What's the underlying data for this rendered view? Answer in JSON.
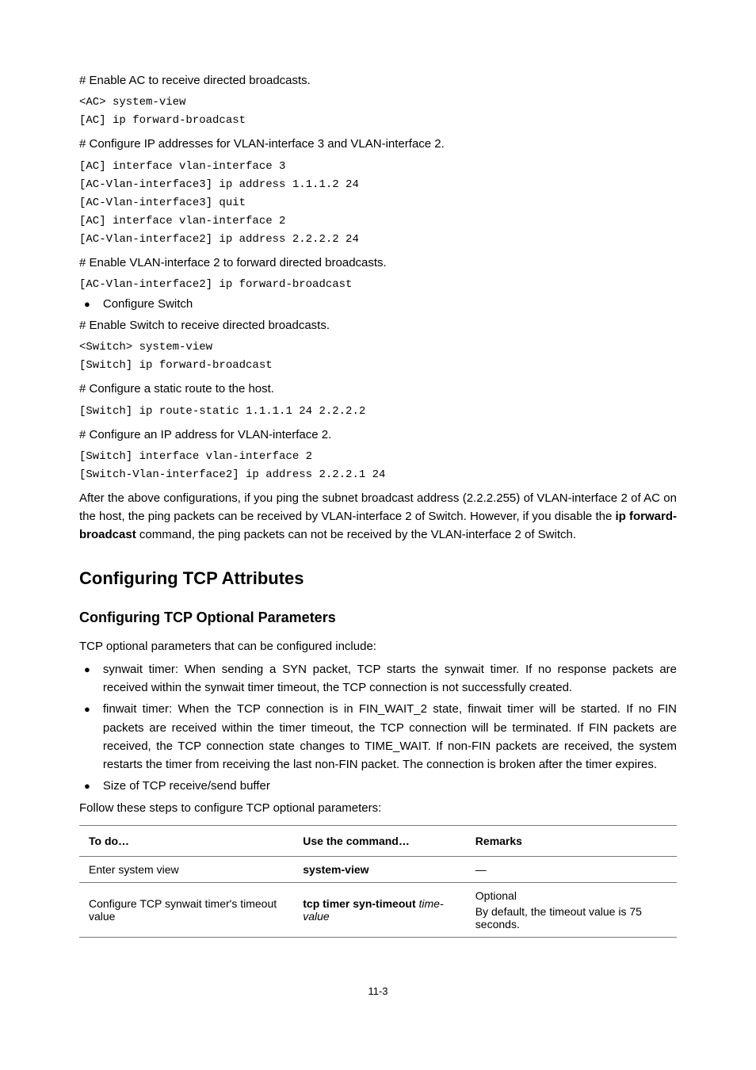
{
  "p1": "# Enable AC to receive directed broadcasts.",
  "c1a": "<AC> system-view",
  "c1b": "[AC] ip forward-broadcast",
  "p2": "# Configure IP addresses for VLAN-interface 3 and VLAN-interface 2.",
  "c2a": "[AC] interface vlan-interface 3",
  "c2b": "[AC-Vlan-interface3] ip address 1.1.1.2 24",
  "c2c": "[AC-Vlan-interface3] quit",
  "c2d": "[AC] interface vlan-interface 2",
  "c2e": "[AC-Vlan-interface2] ip address 2.2.2.2 24",
  "p3": "# Enable VLAN-interface 2 to forward directed broadcasts.",
  "c3a": "[AC-Vlan-interface2] ip forward-broadcast",
  "b1": "Configure Switch",
  "p4": "# Enable Switch to receive directed broadcasts.",
  "c4a": "<Switch> system-view",
  "c4b": "[Switch] ip forward-broadcast",
  "p5": "# Configure a static route to the host.",
  "c5a": "[Switch] ip route-static 1.1.1.1 24 2.2.2.2",
  "p6": "# Configure an IP address for VLAN-interface 2.",
  "c6a": "[Switch] interface vlan-interface 2",
  "c6b": "[Switch-Vlan-interface2] ip address 2.2.2.1 24",
  "para_pre": "After the above configurations, if you ping the subnet broadcast address (2.2.2.255) of VLAN-interface 2 of AC on the host, the ping packets can be received by VLAN-interface 2 of Switch. However, if you disable the ",
  "para_bold": "ip forward-broadcast",
  "para_post": " command, the ping packets can not be received by the VLAN-interface 2 of Switch.",
  "h1": "Configuring TCP Attributes",
  "h2": "Configuring TCP Optional Parameters",
  "t1": "TCP optional parameters that can be configured include:",
  "bul1": "synwait timer: When sending a SYN packet, TCP starts the synwait timer. If no response packets are received within the synwait timer timeout, the TCP connection is not successfully created.",
  "bul2": "finwait timer: When the TCP connection is in FIN_WAIT_2 state, finwait timer will be started. If no FIN packets are received within the timer timeout, the TCP connection will be terminated. If FIN packets are received, the TCP connection state changes to TIME_WAIT. If non-FIN packets are received, the system restarts the timer from receiving the last non-FIN packet. The connection is broken after the timer expires.",
  "bul3": "Size of TCP receive/send buffer",
  "t2": "Follow these steps to configure TCP optional parameters:",
  "th1": "To do…",
  "th2": "Use the command…",
  "th3": "Remarks",
  "r1c1": "Enter system view",
  "r1c2": "system-view",
  "r1c3": "—",
  "r2c1": "Configure TCP synwait timer's timeout value",
  "r2c2_1": "tcp timer syn-timeout",
  "r2c2_2": " time-value",
  "r2c3a": "Optional",
  "r2c3b": "By default, the timeout value is 75 seconds.",
  "pagenum": "11-3"
}
